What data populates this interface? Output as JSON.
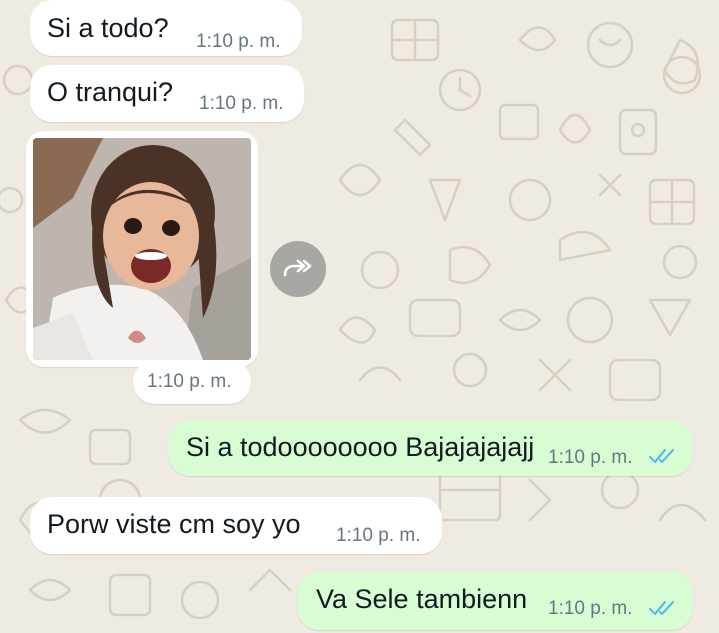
{
  "colors": {
    "wallpaper": "#efeae2",
    "incoming_bubble": "#ffffff",
    "outgoing_bubble": "#d9fdd3",
    "timestamp": "#667781",
    "read_ticks": "#53bdeb",
    "text": "#111b21"
  },
  "messages": [
    {
      "direction": "incoming",
      "text": "Si a todo?",
      "time": "1:10 p. m."
    },
    {
      "direction": "incoming",
      "text": "O tranqui?",
      "time": "1:10 p. m."
    },
    {
      "direction": "incoming",
      "type": "image",
      "icon": "forward-icon",
      "time": "1:10 p. m."
    },
    {
      "direction": "outgoing",
      "text": "Si a todoooooooo Bajajajajajj",
      "time": "1:10 p. m.",
      "status_icon": "double-check-read-icon"
    },
    {
      "direction": "incoming",
      "text": "Porw viste cm soy yo",
      "time": "1:10 p. m."
    },
    {
      "direction": "outgoing",
      "text": "Va Sele tambienn",
      "time": "1:10 p. m.",
      "status_icon": "double-check-read-icon"
    }
  ]
}
